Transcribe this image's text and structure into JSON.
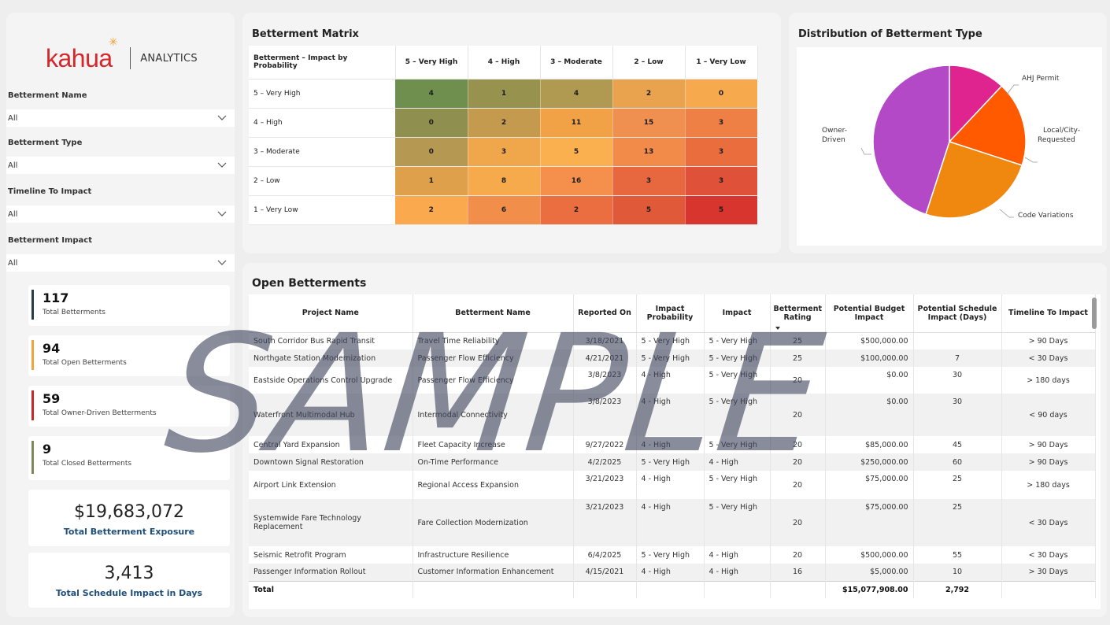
{
  "brand": {
    "logo": "kahua",
    "product": "ANALYTICS"
  },
  "colors": {
    "kpi_total": "#253a4a",
    "kpi_open": "#f2a33a",
    "kpi_owner": "#c9262c",
    "kpi_closed": "#7c8a5b",
    "exposure_label": "#1f4e79"
  },
  "filters": [
    {
      "label": "Betterment Name",
      "value": "All"
    },
    {
      "label": "Betterment Type",
      "value": "All"
    },
    {
      "label": "Timeline To Impact",
      "value": "All"
    },
    {
      "label": "Betterment Impact",
      "value": "All"
    }
  ],
  "kpis": [
    {
      "value": "117",
      "label": "Total Betterments"
    },
    {
      "value": "94",
      "label": "Total Open Betterments"
    },
    {
      "value": "59",
      "label": "Total Owner-Driven Betterments"
    },
    {
      "value": "9",
      "label": "Total Closed Betterments"
    }
  ],
  "big_kpis": [
    {
      "value": "$19,683,072",
      "label": "Total Betterment Exposure"
    },
    {
      "value": "3,413",
      "label": "Total Schedule Impact in Days"
    }
  ],
  "matrix": {
    "title": "Betterment Matrix",
    "corner": "Betterment – Impact by Probability",
    "columns": [
      "5 – Very High",
      "4 – High",
      "3 – Moderate",
      "2 – Low",
      "1 – Very Low"
    ],
    "rows": [
      {
        "label": "5 – Very High",
        "cells": [
          "4",
          "1",
          "4",
          "2",
          "0"
        ],
        "colors": [
          "#6f8f4e",
          "#97934e",
          "#b09a52",
          "#e9a24e",
          "#f7a94d"
        ]
      },
      {
        "label": "4 – High",
        "cells": [
          "0",
          "2",
          "11",
          "15",
          "3"
        ],
        "colors": [
          "#8f8f4f",
          "#c49a4f",
          "#f2a246",
          "#f09050",
          "#ee7f45"
        ]
      },
      {
        "label": "3 – Moderate",
        "cells": [
          "0",
          "3",
          "5",
          "13",
          "3"
        ],
        "colors": [
          "#b59851",
          "#f0a64a",
          "#fbb04f",
          "#f28a4a",
          "#ea6d3d"
        ]
      },
      {
        "label": "2 – Low",
        "cells": [
          "1",
          "8",
          "16",
          "3",
          "3"
        ],
        "colors": [
          "#dfa04c",
          "#f6aa4c",
          "#f4904c",
          "#e7673f",
          "#df5139"
        ]
      },
      {
        "label": "1 – Very Low",
        "cells": [
          "2",
          "6",
          "2",
          "5",
          "5"
        ],
        "colors": [
          "#faa94e",
          "#f18f4a",
          "#ea6e40",
          "#e05a3a",
          "#d8352f"
        ]
      }
    ]
  },
  "pie": {
    "title": "Distribution of Betterment Type",
    "labels": {
      "owner": [
        "Owner-",
        "Driven"
      ],
      "ahj": "AHJ Permit",
      "local": [
        "Local/City-",
        "Requested"
      ],
      "code": "Code Variations"
    }
  },
  "chart_data": {
    "type": "pie",
    "title": "Distribution of Betterment Type",
    "categories": [
      "AHJ Permit",
      "Local/City-Requested",
      "Code Variations",
      "Owner-Driven"
    ],
    "values": [
      12,
      18,
      25,
      45
    ],
    "colors": [
      "#e0248f",
      "#ff5a00",
      "#f0880f",
      "#b349c6"
    ]
  },
  "open_betterments": {
    "title": "Open Betterments",
    "headers": [
      "Project Name",
      "Betterment Name",
      "Reported On",
      "Impact Probability",
      "Impact",
      "Betterment Rating",
      "Potential Budget Impact",
      "Potential Schedule Impact (Days)",
      "Timeline To Impact"
    ],
    "rows": [
      [
        "South Corridor Bus Rapid Transit",
        "Travel Time Reliability",
        "3/18/2021",
        "5 - Very High",
        "5 - Very High",
        "25",
        "$500,000.00",
        "",
        "> 90 Days"
      ],
      [
        "Northgate Station Modernization",
        "Passenger Flow Efficiency",
        "4/21/2021",
        "5 - Very High",
        "5 - Very High",
        "25",
        "$100,000.00",
        "7",
        "< 30 Days"
      ],
      [
        "Eastside Operations Control Upgrade",
        "Passenger Flow Efficiency",
        "3/8/2023",
        "4 - High",
        "5 - Very High",
        "20",
        "$0.00",
        "30",
        "> 180 days"
      ],
      [
        "Waterfront Multimodal Hub",
        "Intermodal Connectivity",
        "3/8/2023",
        "4 - High",
        "5 - Very High",
        "20",
        "$0.00",
        "30",
        "< 90 days"
      ],
      [
        "Central Yard Expansion",
        "Fleet Capacity Increase",
        "9/27/2022",
        "4 - High",
        "5 - Very High",
        "20",
        "$85,000.00",
        "45",
        "> 90 Days"
      ],
      [
        "Downtown Signal Restoration",
        "On-Time Performance",
        "4/2/2025",
        "5 - Very High",
        "4 - High",
        "20",
        "$250,000.00",
        "60",
        "> 90 Days"
      ],
      [
        "Airport Link Extension",
        "Regional Access Expansion",
        "3/21/2023",
        "4 - High",
        "5 - Very High",
        "20",
        "$75,000.00",
        "25",
        "> 180 days"
      ],
      [
        "Systemwide Fare Technology Replacement",
        "Fare Collection Modernization",
        "3/21/2023",
        "4 - High",
        "5 - Very High",
        "20",
        "$75,000.00",
        "25",
        "< 30 Days"
      ],
      [
        "Seismic Retrofit Program",
        "Infrastructure Resilience",
        "6/4/2025",
        "5 - Very High",
        "4 - High",
        "20",
        "$500,000.00",
        "55",
        "< 30 Days"
      ],
      [
        "Passenger Information Rollout",
        "Customer Information Enhancement",
        "4/15/2021",
        "4 - High",
        "4 - High",
        "16",
        "$5,000.00",
        "10",
        "> 30 Days"
      ]
    ],
    "total": {
      "label": "Total",
      "budget": "$15,077,908.00",
      "schedule": "2,792"
    }
  },
  "watermark": "SAMPLE"
}
